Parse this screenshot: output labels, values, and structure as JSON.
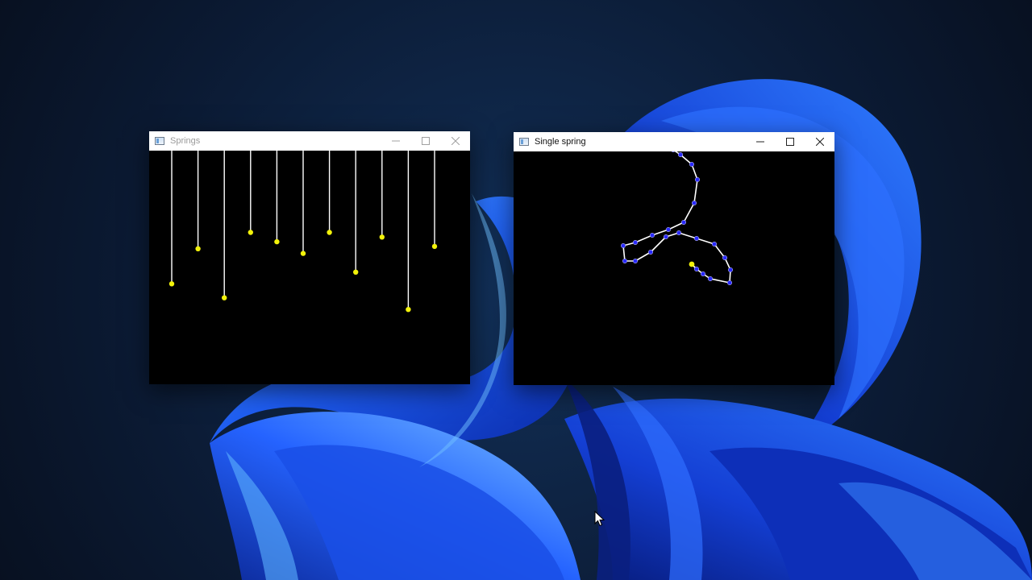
{
  "desktop": {
    "background_color": "#0b1424",
    "wallpaper_accent": "#1a4fe6"
  },
  "windows": [
    {
      "id": "springs",
      "title": "Springs",
      "active": false,
      "icon": "app-window-icon",
      "controls": [
        "minimize-icon",
        "maximize-icon",
        "close-icon"
      ],
      "simulation": {
        "type": "hanging-springs",
        "spring_count": 11,
        "bob_color": "#f2f20a",
        "string_color": "#ffffff",
        "spring_extension_fraction": [
          0.57,
          0.42,
          0.63,
          0.35,
          0.39,
          0.44,
          0.35,
          0.52,
          0.37,
          0.68,
          0.41
        ]
      }
    },
    {
      "id": "single-spring",
      "title": "Single spring",
      "active": true,
      "icon": "app-window-icon",
      "controls": [
        "minimize-icon",
        "maximize-icon",
        "close-icon"
      ],
      "simulation": {
        "type": "single-spring-chain",
        "node_count": 25,
        "node_color": "#2a2aff",
        "end_bob_color": "#f2f20a",
        "string_color": "#ffffff"
      }
    }
  ],
  "cursor": {
    "icon": "mouse-pointer-icon"
  }
}
